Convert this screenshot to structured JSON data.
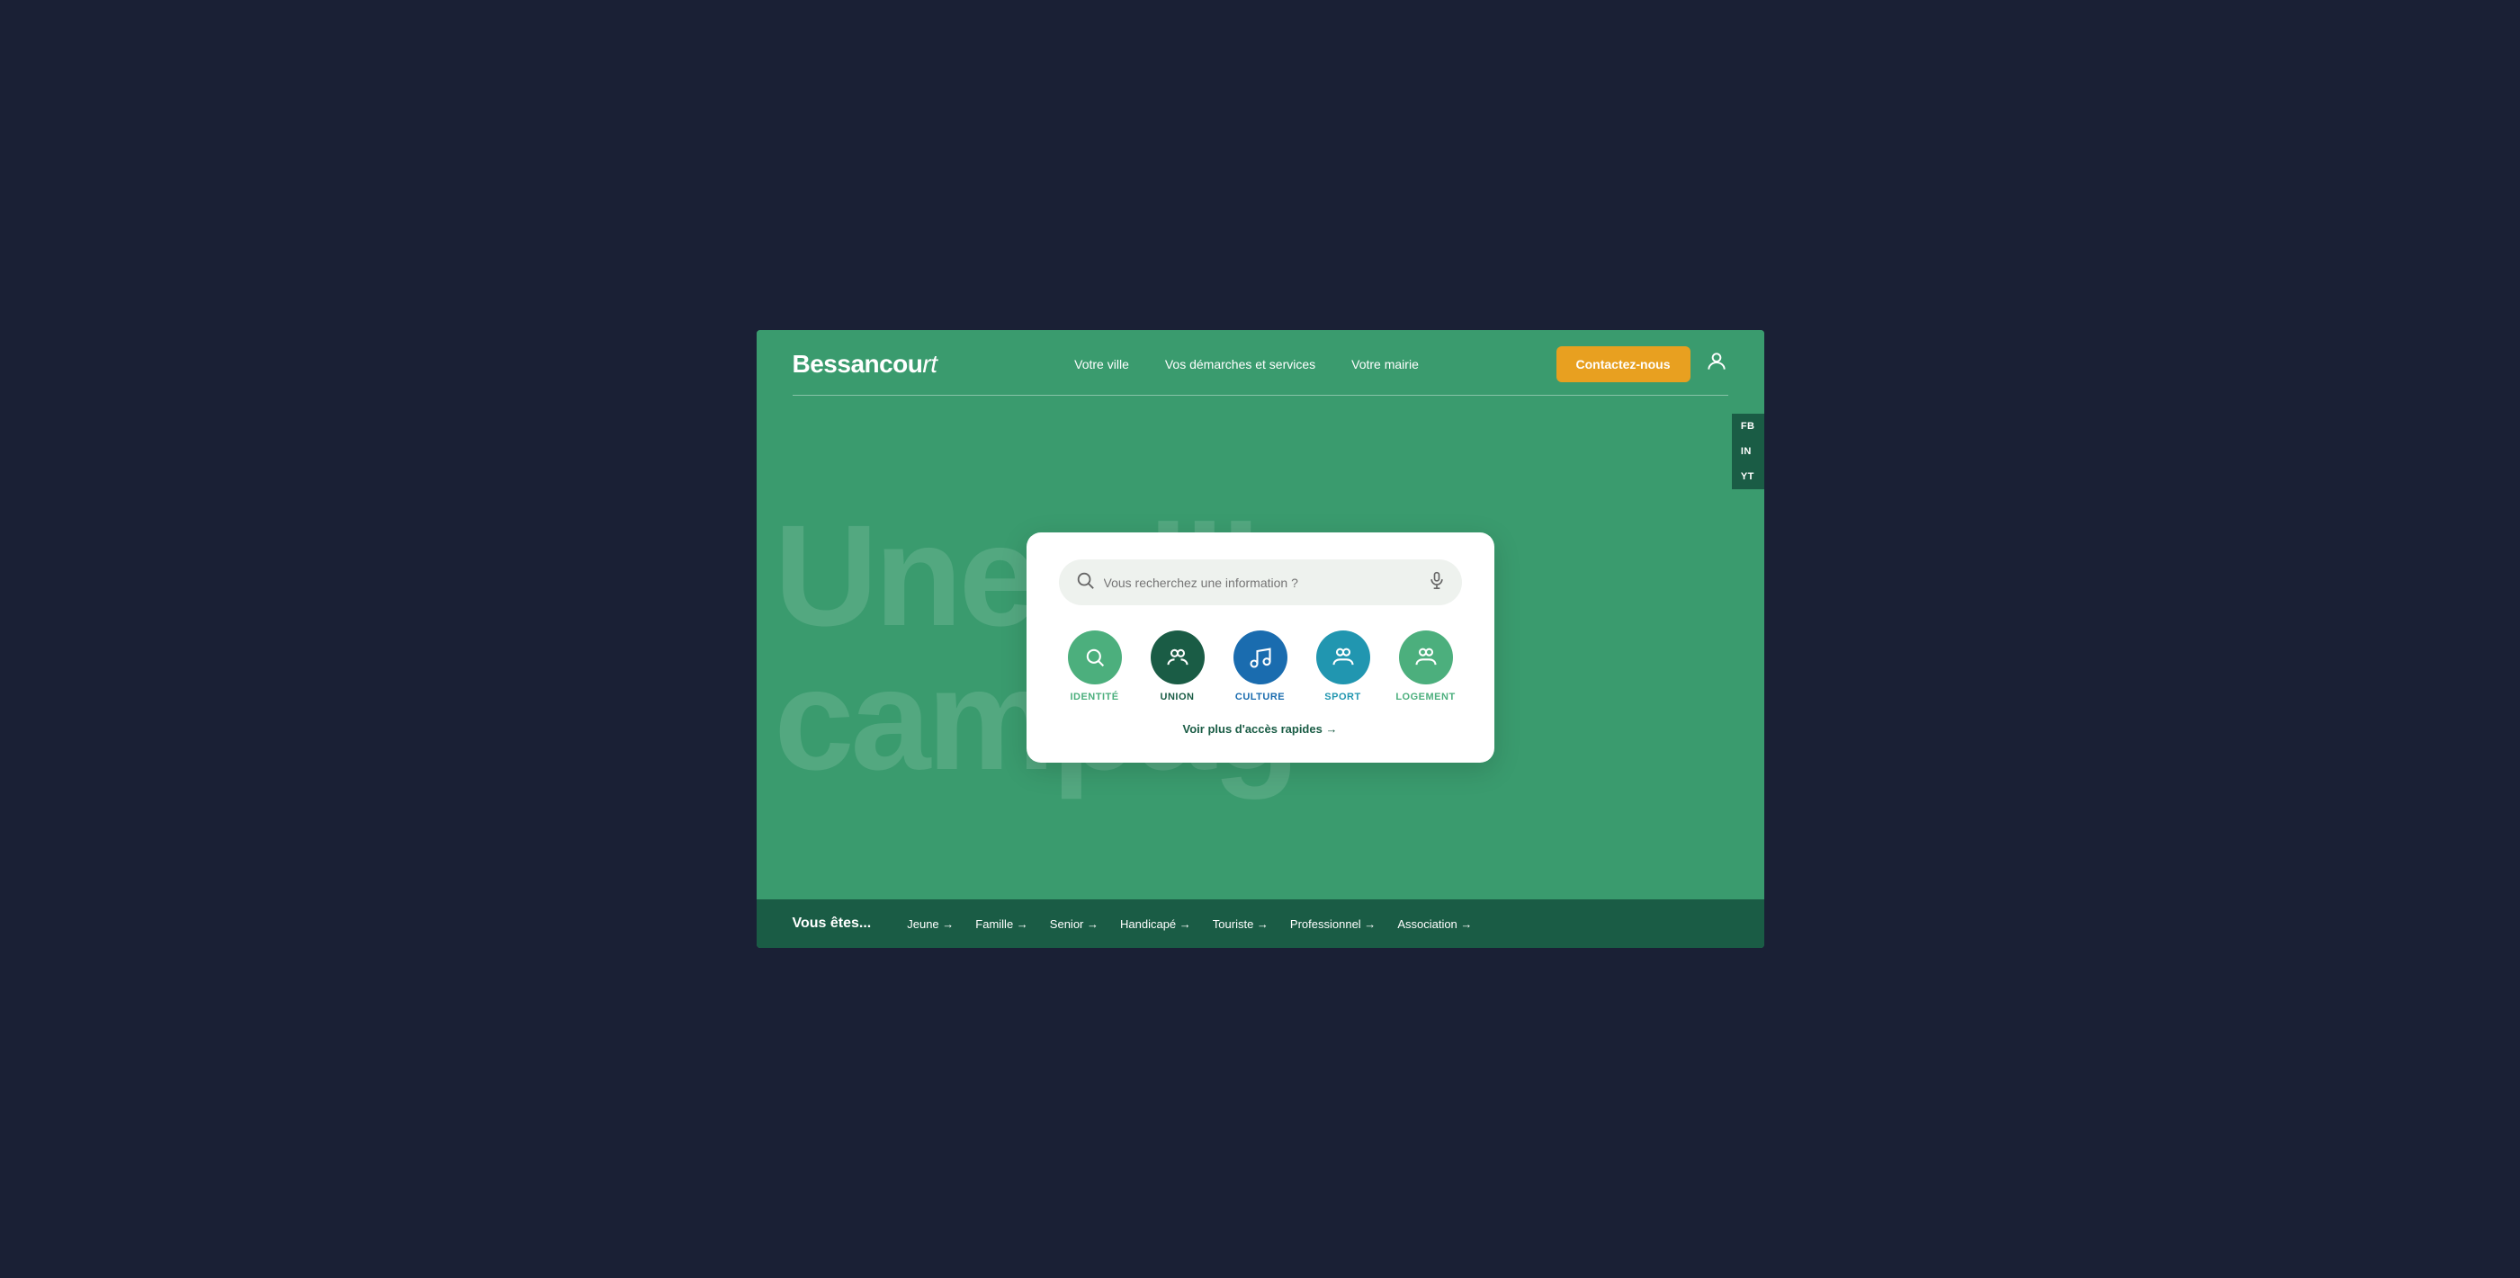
{
  "header": {
    "logo_text": "Bessancourt",
    "logo_suffix": "",
    "nav": [
      {
        "label": "Votre ville",
        "id": "votre-ville"
      },
      {
        "label": "Vos démarches et services",
        "id": "vos-demarches"
      },
      {
        "label": "Votre mairie",
        "id": "votre-mairie"
      }
    ],
    "contact_btn": "Contactez-nous"
  },
  "hero": {
    "bg_lines": [
      "Une ville",
      "campag"
    ]
  },
  "search": {
    "placeholder": "Vous recherchez une information ?"
  },
  "quick_access": [
    {
      "label": "IDENTITÉ",
      "id": "identite",
      "color": "#4caf7d",
      "icon": "search"
    },
    {
      "label": "UNION",
      "id": "union",
      "color": "#1a5c45",
      "icon": "people"
    },
    {
      "label": "CULTURE",
      "id": "culture",
      "color": "#1a6caf",
      "icon": "music"
    },
    {
      "label": "SPORT",
      "id": "sport",
      "color": "#2196b0",
      "icon": "people"
    },
    {
      "label": "LOGEMENT",
      "id": "logement",
      "color": "#4caf7d",
      "icon": "people"
    }
  ],
  "voir_plus": "Voir plus d'accès rapides →",
  "social": [
    {
      "label": "FB",
      "id": "facebook"
    },
    {
      "label": "IN",
      "id": "instagram"
    },
    {
      "label": "YT",
      "id": "youtube"
    }
  ],
  "bottom_bar": {
    "vous_etes": "Vous êtes...",
    "links": [
      {
        "label": "Jeune →"
      },
      {
        "label": "Famille →"
      },
      {
        "label": "Senior →"
      },
      {
        "label": "Handicapé →"
      },
      {
        "label": "Touriste →"
      },
      {
        "label": "Professionnel →"
      },
      {
        "label": "Association →"
      }
    ]
  }
}
